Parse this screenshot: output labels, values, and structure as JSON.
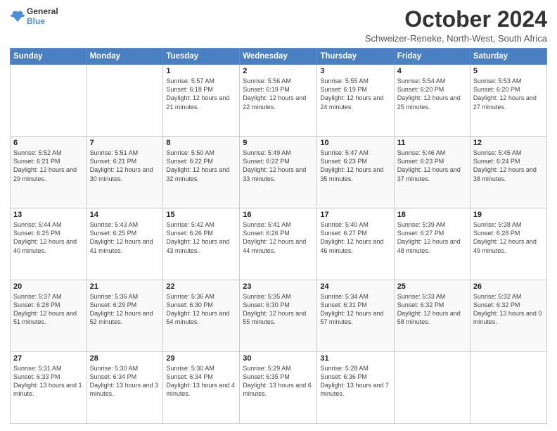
{
  "logo": {
    "line1": "General",
    "line2": "Blue",
    "icon_color": "#4a90d9"
  },
  "title": "October 2024",
  "subtitle": "Schweizer-Reneke, North-West, South Africa",
  "days_of_week": [
    "Sunday",
    "Monday",
    "Tuesday",
    "Wednesday",
    "Thursday",
    "Friday",
    "Saturday"
  ],
  "weeks": [
    [
      {
        "day": "",
        "info": ""
      },
      {
        "day": "",
        "info": ""
      },
      {
        "day": "1",
        "info": "Sunrise: 5:57 AM\nSunset: 6:18 PM\nDaylight: 12 hours and 21 minutes."
      },
      {
        "day": "2",
        "info": "Sunrise: 5:56 AM\nSunset: 6:19 PM\nDaylight: 12 hours and 22 minutes."
      },
      {
        "day": "3",
        "info": "Sunrise: 5:55 AM\nSunset: 6:19 PM\nDaylight: 12 hours and 24 minutes."
      },
      {
        "day": "4",
        "info": "Sunrise: 5:54 AM\nSunset: 6:20 PM\nDaylight: 12 hours and 25 minutes."
      },
      {
        "day": "5",
        "info": "Sunrise: 5:53 AM\nSunset: 6:20 PM\nDaylight: 12 hours and 27 minutes."
      }
    ],
    [
      {
        "day": "6",
        "info": "Sunrise: 5:52 AM\nSunset: 6:21 PM\nDaylight: 12 hours and 29 minutes."
      },
      {
        "day": "7",
        "info": "Sunrise: 5:51 AM\nSunset: 6:21 PM\nDaylight: 12 hours and 30 minutes."
      },
      {
        "day": "8",
        "info": "Sunrise: 5:50 AM\nSunset: 6:22 PM\nDaylight: 12 hours and 32 minutes."
      },
      {
        "day": "9",
        "info": "Sunrise: 5:49 AM\nSunset: 6:22 PM\nDaylight: 12 hours and 33 minutes."
      },
      {
        "day": "10",
        "info": "Sunrise: 5:47 AM\nSunset: 6:23 PM\nDaylight: 12 hours and 35 minutes."
      },
      {
        "day": "11",
        "info": "Sunrise: 5:46 AM\nSunset: 6:23 PM\nDaylight: 12 hours and 37 minutes."
      },
      {
        "day": "12",
        "info": "Sunrise: 5:45 AM\nSunset: 6:24 PM\nDaylight: 12 hours and 38 minutes."
      }
    ],
    [
      {
        "day": "13",
        "info": "Sunrise: 5:44 AM\nSunset: 6:25 PM\nDaylight: 12 hours and 40 minutes."
      },
      {
        "day": "14",
        "info": "Sunrise: 5:43 AM\nSunset: 6:25 PM\nDaylight: 12 hours and 41 minutes."
      },
      {
        "day": "15",
        "info": "Sunrise: 5:42 AM\nSunset: 6:26 PM\nDaylight: 12 hours and 43 minutes."
      },
      {
        "day": "16",
        "info": "Sunrise: 5:41 AM\nSunset: 6:26 PM\nDaylight: 12 hours and 44 minutes."
      },
      {
        "day": "17",
        "info": "Sunrise: 5:40 AM\nSunset: 6:27 PM\nDaylight: 12 hours and 46 minutes."
      },
      {
        "day": "18",
        "info": "Sunrise: 5:39 AM\nSunset: 6:27 PM\nDaylight: 12 hours and 48 minutes."
      },
      {
        "day": "19",
        "info": "Sunrise: 5:38 AM\nSunset: 6:28 PM\nDaylight: 12 hours and 49 minutes."
      }
    ],
    [
      {
        "day": "20",
        "info": "Sunrise: 5:37 AM\nSunset: 6:28 PM\nDaylight: 12 hours and 51 minutes."
      },
      {
        "day": "21",
        "info": "Sunrise: 5:36 AM\nSunset: 6:29 PM\nDaylight: 12 hours and 52 minutes."
      },
      {
        "day": "22",
        "info": "Sunrise: 5:36 AM\nSunset: 6:30 PM\nDaylight: 12 hours and 54 minutes."
      },
      {
        "day": "23",
        "info": "Sunrise: 5:35 AM\nSunset: 6:30 PM\nDaylight: 12 hours and 55 minutes."
      },
      {
        "day": "24",
        "info": "Sunrise: 5:34 AM\nSunset: 6:31 PM\nDaylight: 12 hours and 57 minutes."
      },
      {
        "day": "25",
        "info": "Sunrise: 5:33 AM\nSunset: 6:32 PM\nDaylight: 12 hours and 58 minutes."
      },
      {
        "day": "26",
        "info": "Sunrise: 5:32 AM\nSunset: 6:32 PM\nDaylight: 13 hours and 0 minutes."
      }
    ],
    [
      {
        "day": "27",
        "info": "Sunrise: 5:31 AM\nSunset: 6:33 PM\nDaylight: 13 hours and 1 minute."
      },
      {
        "day": "28",
        "info": "Sunrise: 5:30 AM\nSunset: 6:34 PM\nDaylight: 13 hours and 3 minutes."
      },
      {
        "day": "29",
        "info": "Sunrise: 5:30 AM\nSunset: 6:34 PM\nDaylight: 13 hours and 4 minutes."
      },
      {
        "day": "30",
        "info": "Sunrise: 5:29 AM\nSunset: 6:35 PM\nDaylight: 13 hours and 6 minutes."
      },
      {
        "day": "31",
        "info": "Sunrise: 5:28 AM\nSunset: 6:36 PM\nDaylight: 13 hours and 7 minutes."
      },
      {
        "day": "",
        "info": ""
      },
      {
        "day": "",
        "info": ""
      }
    ]
  ]
}
